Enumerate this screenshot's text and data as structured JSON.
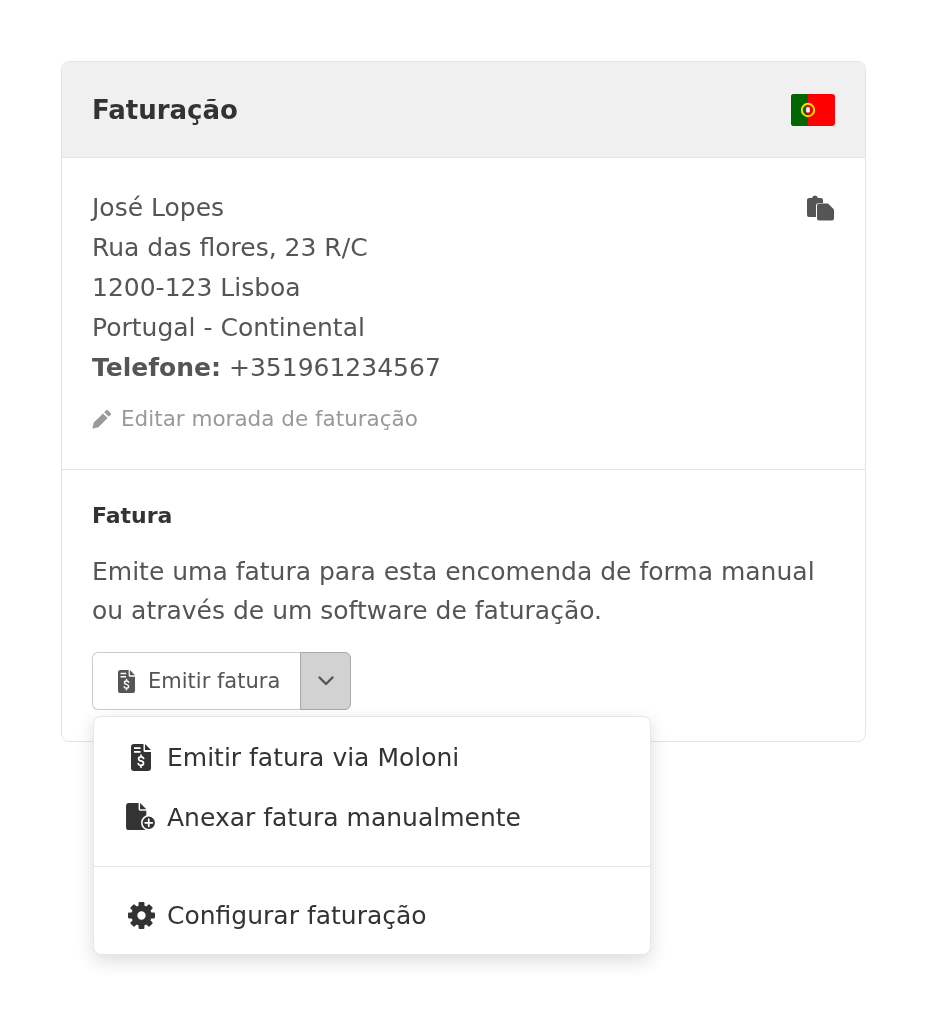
{
  "panel": {
    "title": "Faturação"
  },
  "address": {
    "name": "José Lopes",
    "lines": [
      "Rua das flores, 23 R/C",
      "1200-123 Lisboa",
      "Portugal - Continental"
    ],
    "phone": "**Telefone:** +351961234567",
    "edit_link": "Editar morada de faturação"
  },
  "invoice": {
    "title": "Fatura",
    "description": "Emite uma fatura para esta encomenda de forma manual ou através de um software de faturação.",
    "button": {
      "label": "Emitir fatura"
    },
    "dropdown": {
      "expanded": true,
      "sections": [
        {
          "items": [
            {
              "label": "Emitir fatura via Moloni",
              "kind": "invoice"
            },
            {
              "label": "Anexar fatura manualmente",
              "kind": "attach"
            }
          ]
        },
        {
          "items": [
            {
              "label": "Configurar faturação",
              "kind": "settings"
            }
          ]
        }
      ]
    }
  }
}
